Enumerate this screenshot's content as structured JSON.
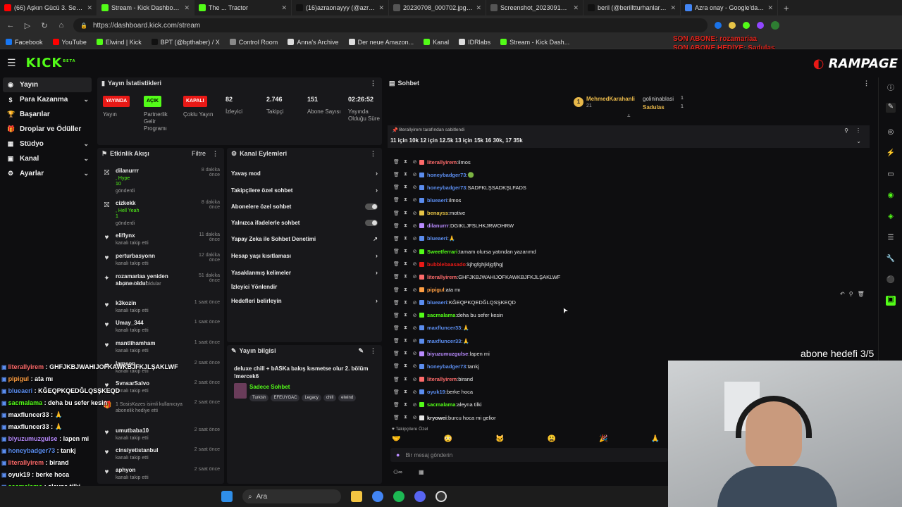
{
  "browser": {
    "tabs": [
      {
        "label": "(66) Aşkın Gücü 3. Sezon",
        "color": "#ff0000"
      },
      {
        "label": "Stream - Kick Dashboard",
        "color": "#53fc18"
      },
      {
        "label": "The ... Tractor",
        "color": "#53fc18"
      },
      {
        "label": "(16)azraonayyy (@azraon",
        "color": "#111111"
      },
      {
        "label": "20230708_000702.jpg (8(",
        "color": "#555555"
      },
      {
        "label": "Screenshot_20230912_12",
        "color": "#555555"
      },
      {
        "label": "beril (@berilltturhanlar) | T",
        "color": "#111111"
      },
      {
        "label": "Azra onay - Google'da Ar",
        "color": "#4285f4"
      }
    ],
    "url": "https://dashboard.kick.com/stream",
    "bookmarks": [
      {
        "label": "Facebook",
        "color": "#1877f2"
      },
      {
        "label": "YouTube",
        "color": "#ff0000"
      },
      {
        "label": "Elwind | Kick",
        "color": "#53fc18"
      },
      {
        "label": "BPT (@bpthaber) / X",
        "color": "#111111"
      },
      {
        "label": "Control Room",
        "color": "#888888"
      },
      {
        "label": "Anna's Archive",
        "color": "#dddddd"
      },
      {
        "label": "Der neue Amazon...",
        "color": "#dddddd"
      },
      {
        "label": "Kanal",
        "color": "#53fc18"
      },
      {
        "label": "IDRlabs",
        "color": "#dddddd"
      },
      {
        "label": "Stream - Kick Dash...",
        "color": "#53fc18"
      }
    ]
  },
  "overlay_top": {
    "line1": "SON ABONE: rozamariaa",
    "line2": "SON ABONE HEDİYE: Sadulas"
  },
  "brand": {
    "logo": "KICK",
    "beta": "BETA",
    "rampage": "RAMPAGE"
  },
  "sidebar": [
    {
      "label": "Yayın",
      "icon": "broadcast-icon",
      "active": true
    },
    {
      "label": "Para Kazanma",
      "icon": "money-icon",
      "chev": true
    },
    {
      "label": "Başarılar",
      "icon": "trophy-icon"
    },
    {
      "label": "Droplar ve Ödüller",
      "icon": "gift-icon"
    },
    {
      "label": "Stüdyo",
      "icon": "studio-icon",
      "chev": true
    },
    {
      "label": "Kanal",
      "icon": "channel-icon",
      "chev": true
    },
    {
      "label": "Ayarlar",
      "icon": "settings-icon",
      "chev": true
    }
  ],
  "stats": {
    "title": "Yayın İstatistikleri",
    "items": [
      {
        "badge": "YAYINDA",
        "badge_color": "#e91916",
        "label": "Yayın"
      },
      {
        "badge": "AÇIK",
        "badge_color": "#53fc18",
        "label": "Partnerlik Gelir Programı"
      },
      {
        "badge": "KAPALI",
        "badge_color": "#e91916",
        "label": "Çoklu Yayın"
      },
      {
        "value": "82",
        "label": "İzleyici"
      },
      {
        "value": "2.746",
        "label": "Takipçi"
      },
      {
        "value": "151",
        "label": "Abone Sayısı"
      },
      {
        "value": "02:26:52",
        "label": "Yayında Olduğu Süre"
      }
    ]
  },
  "activity": {
    "title": "Etkinlik Akışı",
    "filter": "Filtre",
    "items": [
      {
        "name": "dilanurrr",
        "sub": ", Hype",
        "extra": "10",
        "sub2": "gönderdi",
        "time": "8 dakika önce",
        "icon": "kick-gift-icon"
      },
      {
        "name": "cizkekk",
        "sub": ", Hell Yeah",
        "extra": "1",
        "sub2": "gönderdi",
        "time": "8 dakika önce",
        "icon": "kick-gift-icon"
      },
      {
        "name": "eliflynx",
        "sub": "kanalı takip etti",
        "time": "11 dakika önce",
        "icon": "heart-icon"
      },
      {
        "name": "perturbasyonn",
        "sub": "kanalı takip etti",
        "time": "12 dakika önce",
        "icon": "heart-icon"
      },
      {
        "name": "rozamariaa yeniden abone oldu!",
        "sub": "8 aylık abone oldular",
        "time": "51 dakika önce",
        "icon": "star-icon"
      },
      {
        "name": "k3kozin",
        "sub": "kanalı takip etti",
        "time": "1 saat önce",
        "icon": "heart-icon"
      },
      {
        "name": "Umay_344",
        "sub": "kanalı takip etti",
        "time": "1 saat önce",
        "icon": "heart-icon"
      },
      {
        "name": "mantlihamham",
        "sub": "kanalı takip etti",
        "time": "1 saat önce",
        "icon": "heart-icon"
      },
      {
        "name": "lamson",
        "sub": "kanalı takip etti",
        "time": "2 saat önce",
        "icon": "heart-icon"
      },
      {
        "name": "SvnsarSalvo",
        "sub": "kanalı takip etti",
        "time": "2 saat önce",
        "icon": "heart-icon"
      },
      {
        "name": "",
        "sub": "1 SosisKazes isimli kullanıcıya abonelik hediye etti",
        "time": "2 saat önce",
        "icon": "gift-icon"
      },
      {
        "name": "umutbaba10",
        "sub": "kanalı takip etti",
        "time": "2 saat önce",
        "icon": "heart-icon"
      },
      {
        "name": "cinsiyetistanbul",
        "sub": "kanalı takip etti",
        "time": "2 saat önce",
        "icon": "heart-icon"
      },
      {
        "name": "aphyon",
        "sub": "kanalı takip etti",
        "time": "2 saat önce",
        "icon": "heart-icon"
      }
    ]
  },
  "channel_actions": {
    "title": "Kanal Eylemleri",
    "items": [
      {
        "label": "Yavaş mod",
        "type": "chevron"
      },
      {
        "label": "Takipçilere özel sohbet",
        "type": "chevron"
      },
      {
        "label": "Abonelere özel sohbet",
        "type": "toggle"
      },
      {
        "label": "Yalnızca ifadelerle sohbet",
        "type": "toggle"
      },
      {
        "label": "Yapay Zeka ile Sohbet Denetimi",
        "type": "external"
      },
      {
        "label": "Hesap yaşı kısıtlaması",
        "type": "chevron"
      },
      {
        "label": "Yasaklanmış kelimeler",
        "type": "chevron"
      },
      {
        "label": "İzleyici Yönlendir",
        "type": "none"
      },
      {
        "label": "Hedefleri belirleyin",
        "type": "chevron"
      }
    ]
  },
  "stream_info": {
    "title": "Yayın bilgisi",
    "stream_title": "deluxe chill + bASKa bakış kısmetse olur 2. bölüm !mercek6",
    "category": "Sadece Sohbet",
    "tags": [
      "Turkish",
      "EFEUYGAC",
      "Legacy",
      "chill",
      "elwind"
    ]
  },
  "chat": {
    "title": "Sohbet",
    "top_gifters": [
      {
        "name": "MehmedKarahanli",
        "count": "21"
      },
      {
        "name": "golininablasi",
        "count": "1"
      },
      {
        "name": "Sadulas",
        "count": "1"
      }
    ],
    "pinned_by": "literallyirem tarafından sabitlendi",
    "pinned_text": "11 için 10k 12 için 12.5k 13 için 15k 16 30k, 17 35k",
    "messages": [
      {
        "user": "literallyirem",
        "color": "#ff6b6b",
        "text": "ilmos"
      },
      {
        "user": "honeybadger73",
        "color": "#5b8def",
        "text": "🟢"
      },
      {
        "user": "honeybadger73",
        "color": "#5b8def",
        "text": "SADFKLŞSADKŞLFADS"
      },
      {
        "user": "blueaeri",
        "color": "#5b8def",
        "text": "ilmos"
      },
      {
        "user": "benayss",
        "color": "#e8c547",
        "text": "motive"
      },
      {
        "user": "dilanurrr",
        "color": "#b98bff",
        "text": "DGIKLJFSLHKJRWOHRW"
      },
      {
        "user": "blueaeri",
        "color": "#5b8def",
        "text": "🙏"
      },
      {
        "user": "Sweetferrari",
        "color": "#53fc18",
        "text": "tamam olursa yatından yazarımd"
      },
      {
        "user": "bubblebaasado",
        "color": "#e91916",
        "text": "kjhgfghjkljgfjhg|"
      },
      {
        "user": "literallyirem",
        "color": "#ff6b6b",
        "text": "GHFJKBJWAHIJOFKAWKBJFKJLŞAKLWF"
      },
      {
        "user": "pipigul",
        "color": "#ff9f43",
        "text": "ata mı"
      },
      {
        "user": "blueaeri",
        "color": "#5b8def",
        "text": "KĞEQPKQEDĞLQSŞKEQD"
      },
      {
        "user": "sacmalama",
        "color": "#53fc18",
        "text": "deha bu sefer kesin"
      },
      {
        "user": "maxfluncer33",
        "color": "#5b8def",
        "text": "🙏"
      },
      {
        "user": "maxfluncer33",
        "color": "#5b8def",
        "text": "🙏"
      },
      {
        "user": "biyuzumuzgulse",
        "color": "#b98bff",
        "text": "lapen mi"
      },
      {
        "user": "honeybadger73",
        "color": "#5b8def",
        "text": "tarıkj"
      },
      {
        "user": "literallyirem",
        "color": "#ff6b6b",
        "text": "birand"
      },
      {
        "user": "oyuk19",
        "color": "#5b8def",
        "text": "berke hoca"
      },
      {
        "user": "sacmalama",
        "color": "#53fc18",
        "text": "aleyna tilki"
      },
      {
        "user": "kryowei",
        "color": "#e8e8e8",
        "text": "burcu hoca mi gelior"
      }
    ],
    "followers_only": "Takipçilere Özel",
    "input_placeholder": "Bir mesaj gönderin"
  },
  "overlay_chat": [
    {
      "user": "literallyirem",
      "color": "#ff6b6b",
      "text": "GHFJKBJWAHIJOFKAWKBJFKJLŞAKLWF"
    },
    {
      "user": "pipigul",
      "color": "#ff9f43",
      "text": "ata mı"
    },
    {
      "user": "blueaeri",
      "color": "#5b8def",
      "text": "KĞEQPKQEDĞLQSŞKEQD"
    },
    {
      "user": "sacmalama",
      "color": "#53fc18",
      "text": "deha bu sefer kesin"
    },
    {
      "user": "maxfluncer33",
      "color": "#ffffff",
      "text": "🙏"
    },
    {
      "user": "maxfluncer33",
      "color": "#ffffff",
      "text": "🙏"
    },
    {
      "user": "biyuzumuzgulse",
      "color": "#b98bff",
      "text": "lapen mi"
    },
    {
      "user": "honeybadger73",
      "color": "#5b8def",
      "text": "tarıkj"
    },
    {
      "user": "literallyirem",
      "color": "#ff6b6b",
      "text": "birand"
    },
    {
      "user": "oyuk19",
      "color": "#ffffff",
      "text": "berke hoca"
    },
    {
      "user": "sacmalama",
      "color": "#53fc18",
      "text": "aleyna tilki"
    },
    {
      "user": "kryowei",
      "color": "#ffffff",
      "text": "burcu hoca mi gelior"
    }
  ],
  "abone_hedefi": "abone hedefi 3/5",
  "taskbar": {
    "search": "Ara"
  },
  "colors": {
    "kick_green": "#53fc18",
    "live_red": "#e91916",
    "panel": "#18181b",
    "bg": "#0e0e10"
  }
}
